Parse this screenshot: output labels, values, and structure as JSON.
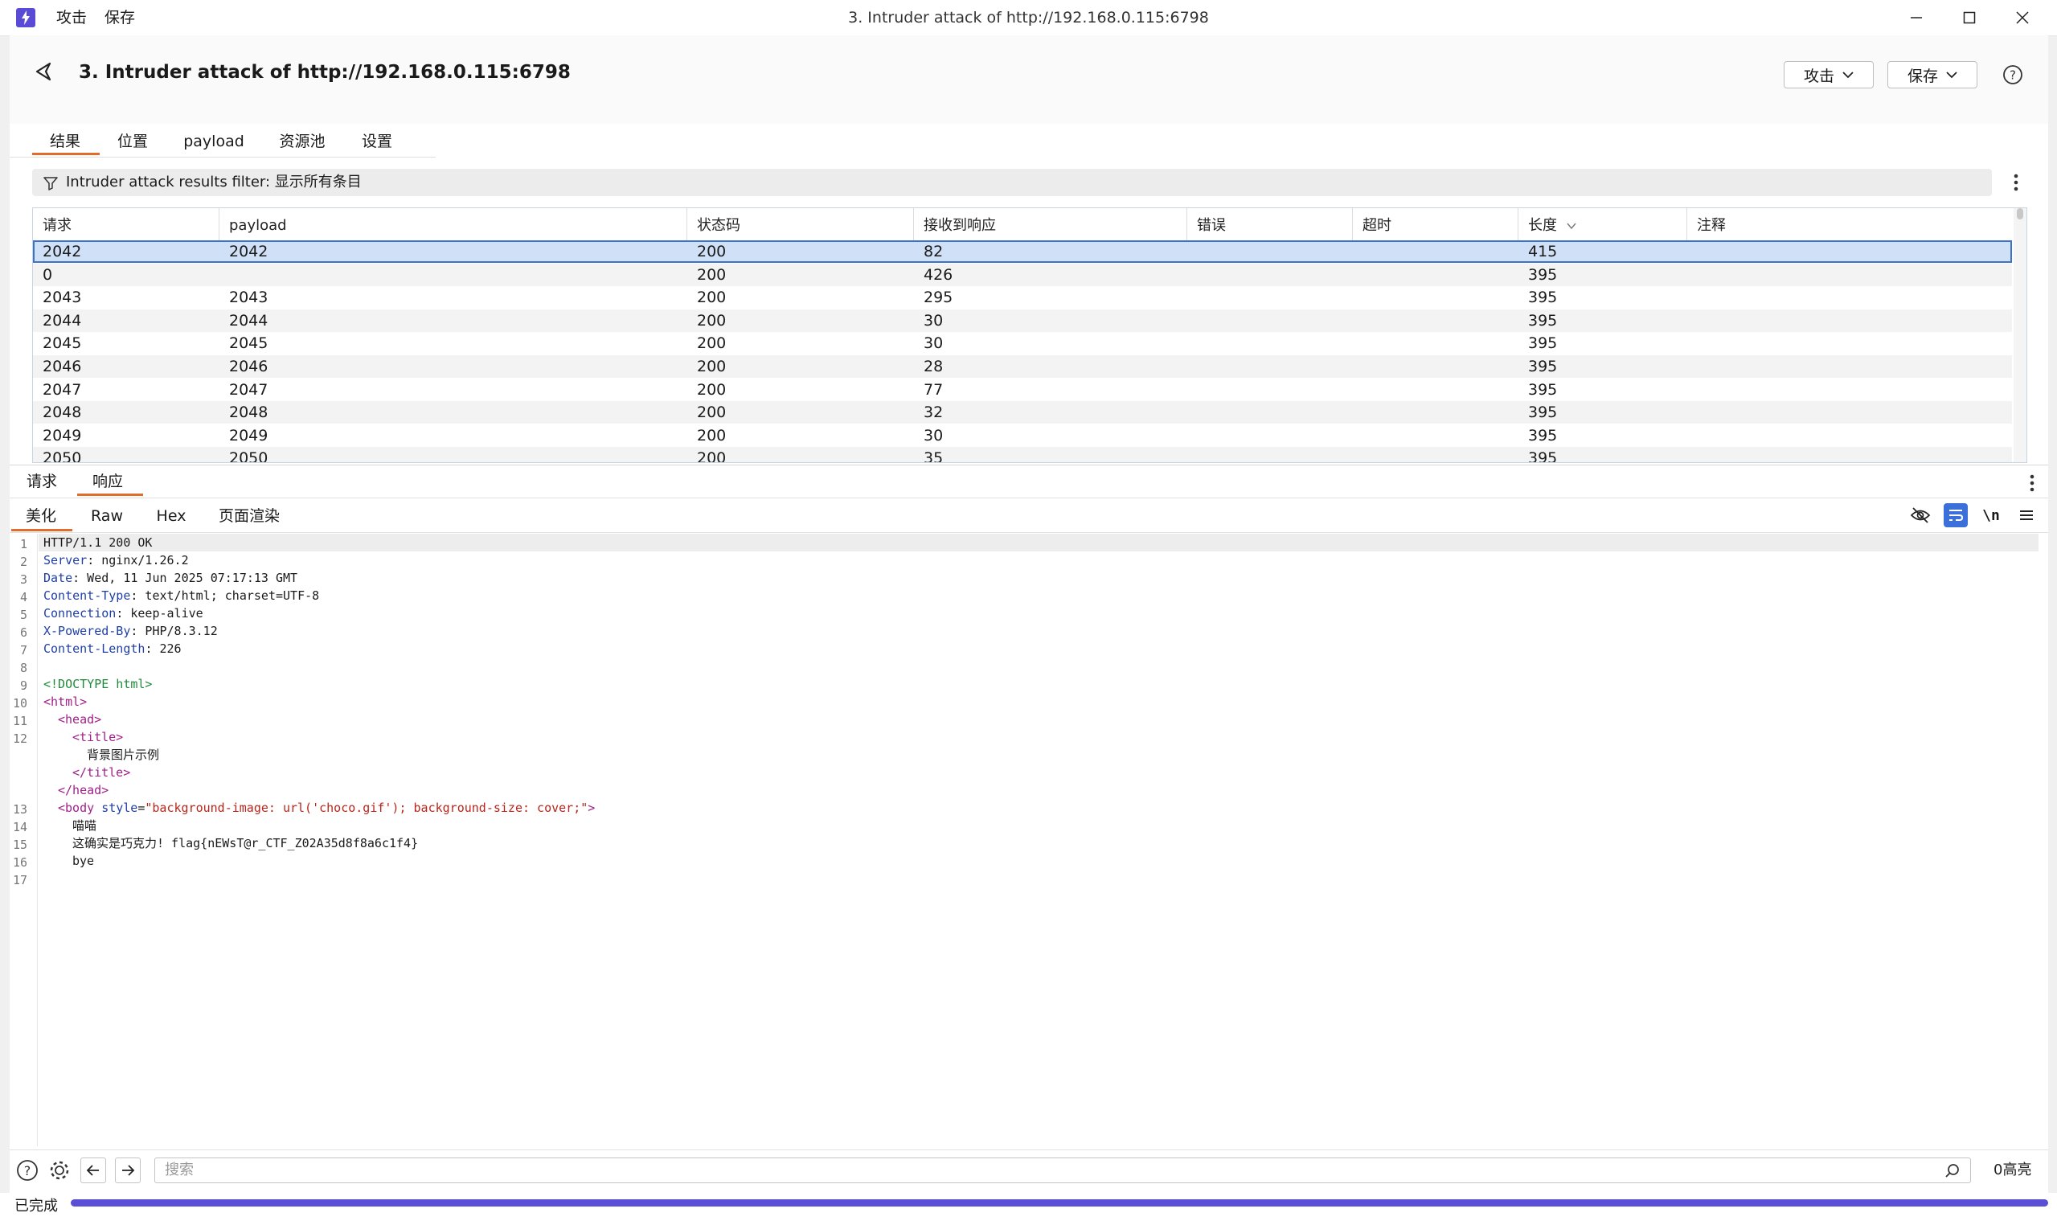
{
  "window": {
    "menu": [
      "攻击",
      "保存"
    ],
    "title": "3. Intruder attack of http://192.168.0.115:6798"
  },
  "header": {
    "title": "3. Intruder attack of http://192.168.0.115:6798",
    "attack_button": "攻击",
    "save_button": "保存"
  },
  "tabs": [
    "结果",
    "位置",
    "payload",
    "资源池",
    "设置"
  ],
  "active_tab": "结果",
  "filter": {
    "label": "Intruder attack results filter: 显示所有条目"
  },
  "table": {
    "columns": [
      "请求",
      "payload",
      "状态码",
      "接收到响应",
      "错误",
      "超时",
      "长度",
      "注释"
    ],
    "sort_column": "长度",
    "rows": [
      [
        "2042",
        "2042",
        "200",
        "82",
        "",
        "",
        "415",
        ""
      ],
      [
        "0",
        "",
        "200",
        "426",
        "",
        "",
        "395",
        ""
      ],
      [
        "2043",
        "2043",
        "200",
        "295",
        "",
        "",
        "395",
        ""
      ],
      [
        "2044",
        "2044",
        "200",
        "30",
        "",
        "",
        "395",
        ""
      ],
      [
        "2045",
        "2045",
        "200",
        "30",
        "",
        "",
        "395",
        ""
      ],
      [
        "2046",
        "2046",
        "200",
        "28",
        "",
        "",
        "395",
        ""
      ],
      [
        "2047",
        "2047",
        "200",
        "77",
        "",
        "",
        "395",
        ""
      ],
      [
        "2048",
        "2048",
        "200",
        "32",
        "",
        "",
        "395",
        ""
      ],
      [
        "2049",
        "2049",
        "200",
        "30",
        "",
        "",
        "395",
        ""
      ],
      [
        "2050",
        "2050",
        "200",
        "35",
        "",
        "",
        "395",
        ""
      ]
    ],
    "selected_row": 0
  },
  "panel_tabs": [
    "请求",
    "响应"
  ],
  "active_panel_tab": "响应",
  "view_tabs": [
    "美化",
    "Raw",
    "Hex",
    "页面渲染"
  ],
  "active_view_tab": "美化",
  "toolbar_icons": [
    "eye-off-icon",
    "wrap-icon",
    "newline-icon",
    "menu-icon"
  ],
  "response": {
    "line_numbers": [
      "1",
      "2",
      "3",
      "4",
      "5",
      "6",
      "7",
      "8",
      "9",
      "10",
      "11",
      "12",
      "13",
      "14",
      "15",
      "16",
      "17"
    ],
    "lines": {
      "l1": "HTTP/1.1 200 OK",
      "l2_k": "Server",
      "l2_v": ": nginx/1.26.2",
      "l3_k": "Date",
      "l3_v": ": Wed, 11 Jun 2025 07:17:13 GMT",
      "l4_k": "Content-Type",
      "l4_v": ": text/html; charset=UTF-8",
      "l5_k": "Connection",
      "l5_v": ": keep-alive",
      "l6_k": "X-Powered-By",
      "l6_v": ": PHP/8.3.12",
      "l7_k": "Content-Length",
      "l7_v": ": 226",
      "l9": "<!DOCTYPE html>",
      "l10": "<html>",
      "l11": "<head>",
      "l12a": "<title>",
      "l12b": "背景图片示例",
      "l12c": "</title>",
      "l13": "</head>",
      "l14_tag": "<body",
      "l14_attr": "style",
      "l14_eq": "=",
      "l14_val": "\"background-image: url('choco.gif'); background-size: cover;\"",
      "l14_end": ">",
      "l15": "喵喵",
      "l16": "这确实是巧克力! flag{nEWsT@r_CTF_Z02A35d8f8a6c1f4}",
      "l17": "bye"
    }
  },
  "search": {
    "placeholder": "搜索",
    "highlight_count": "0高亮"
  },
  "status": {
    "text": "已完成",
    "progress": 1.0
  },
  "colors": {
    "accent": "#5b4fd6",
    "tab_underline": "#e36b2c",
    "selected_row": "#cfe0f7"
  }
}
